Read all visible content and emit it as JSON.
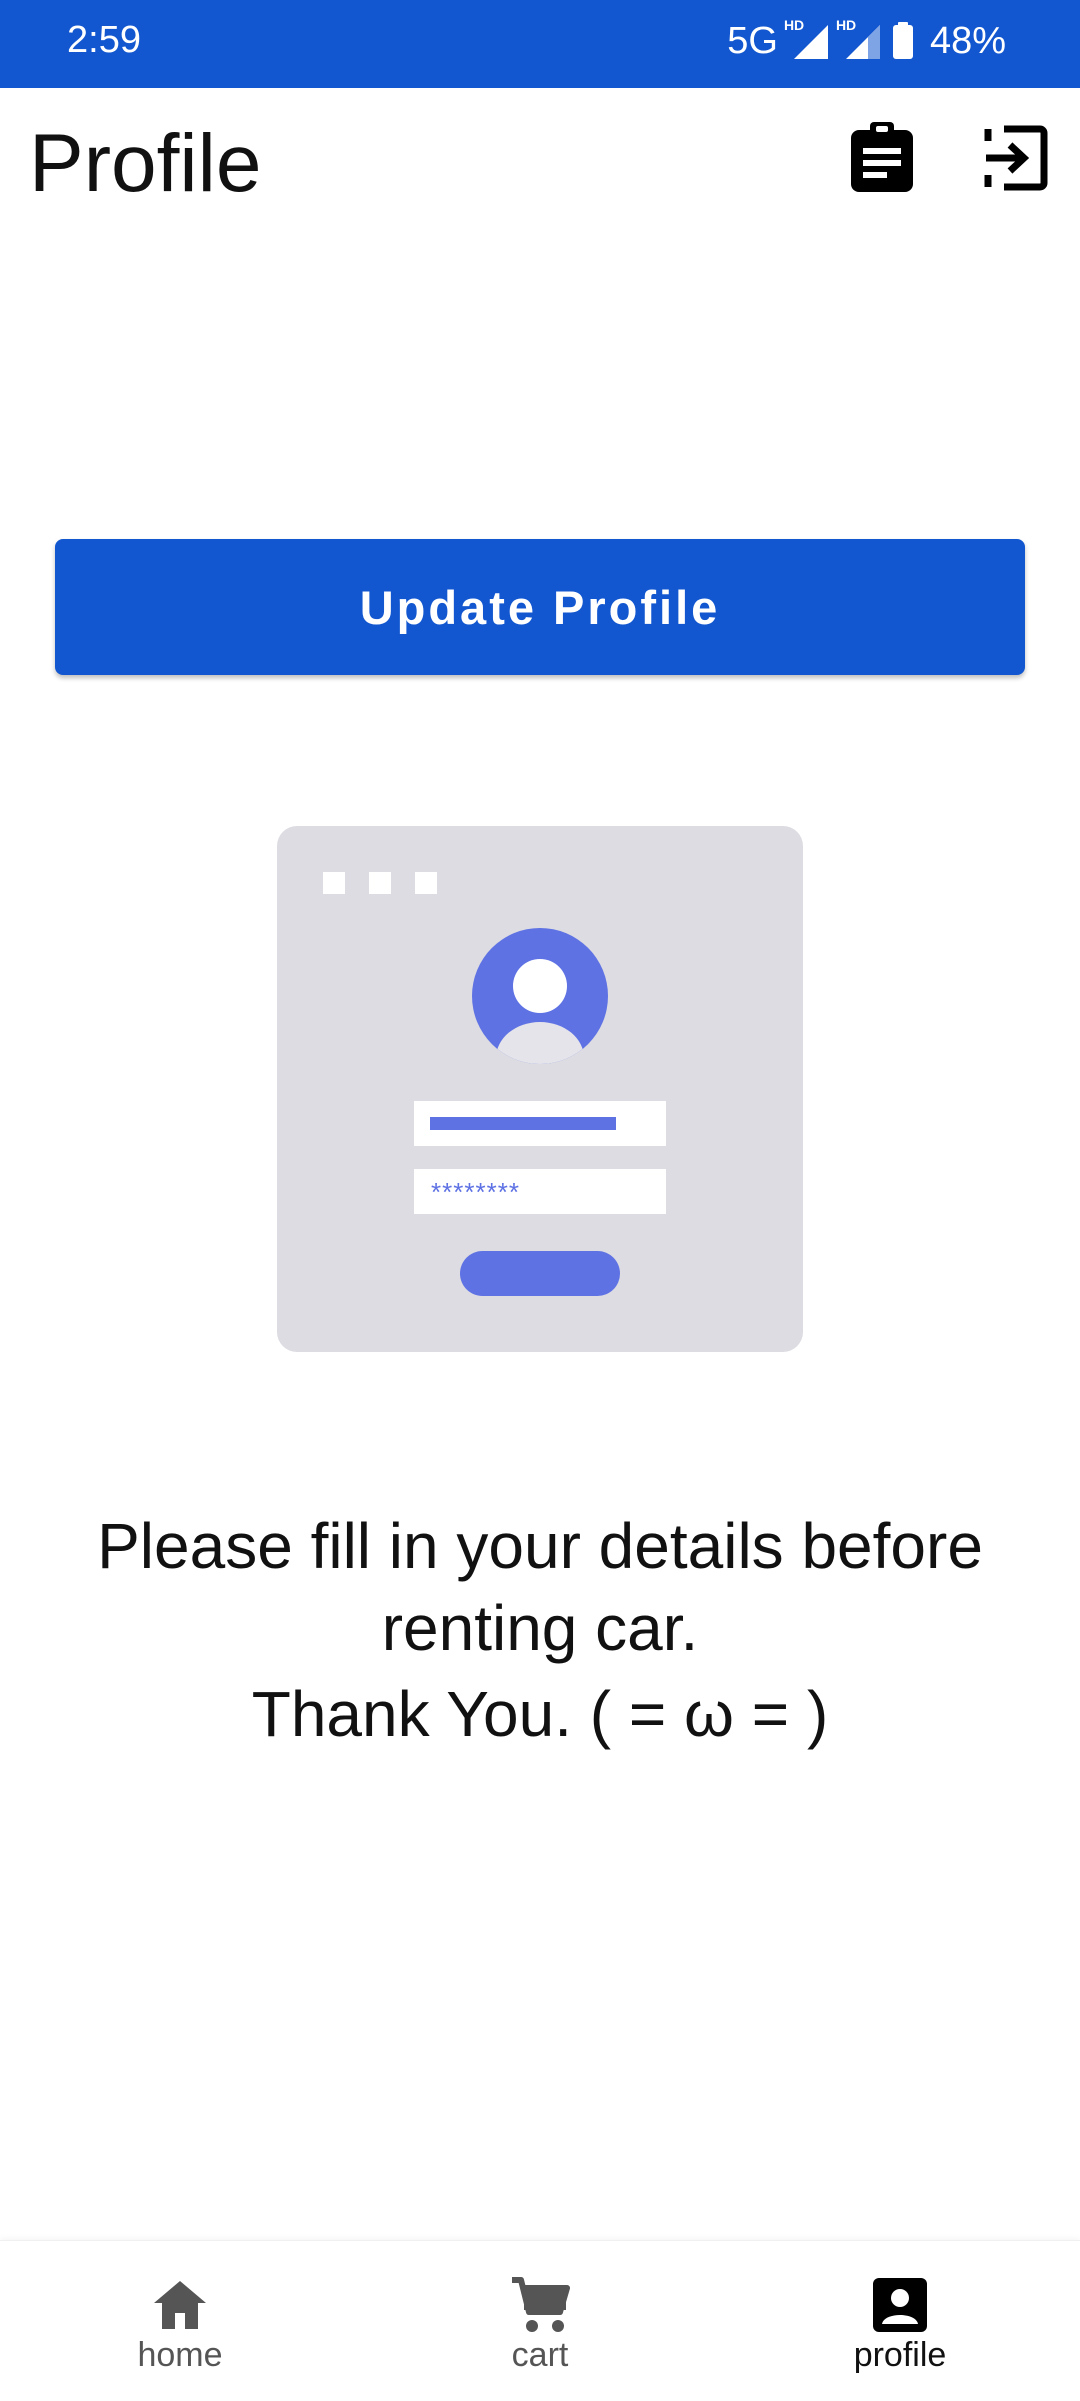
{
  "status_bar": {
    "time": "2:59",
    "network": "5G",
    "sim1_badge": "HD",
    "sim2_badge": "HD",
    "battery": "48%",
    "background_color": "#1257D0"
  },
  "app_bar": {
    "title": "Profile",
    "actions": [
      {
        "icon": "clipboard-icon"
      },
      {
        "icon": "logout-icon"
      }
    ]
  },
  "main": {
    "update_button_label": "Update Profile",
    "illustration": {
      "icon": "profile-form-illustration",
      "password_mask": "********"
    },
    "message_line1": "Please fill in your details before renting car.",
    "message_line2": "Thank You. ( = ω = )"
  },
  "bottom_nav": {
    "items": [
      {
        "label": "home",
        "icon": "home-icon",
        "active": false
      },
      {
        "label": "cart",
        "icon": "cart-icon",
        "active": false
      },
      {
        "label": "profile",
        "icon": "account-box-icon",
        "active": true
      }
    ]
  },
  "colors": {
    "primary": "#1257D0",
    "illustration_accent": "#5E72E4",
    "illustration_bg": "#DCDCE2"
  }
}
